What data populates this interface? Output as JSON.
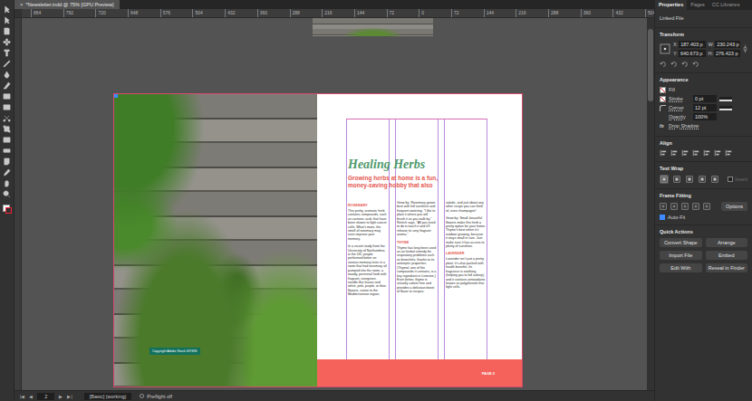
{
  "document_tab": {
    "close": "×",
    "title": "*Newsletter.indd @ 75% [GPU Preview]"
  },
  "ruler": {
    "ticks": [
      "864",
      "792",
      "720",
      "648",
      "576",
      "504",
      "432",
      "360",
      "288",
      "216",
      "144",
      "72",
      "0",
      "72",
      "144",
      "216",
      "288",
      "360",
      "432",
      "504"
    ]
  },
  "page": {
    "caption": "Copyright Adobe Stock 097496",
    "title": "Healing Herbs",
    "subtitle": "Growing herbs at home is a fun, money-saving hobby that also",
    "columns": [
      {
        "blocks": [
          {
            "kind": "heading",
            "text": "ROSEMARY"
          },
          {
            "kind": "body",
            "text": "This pretty, aromatic herb contains compounds, such as carnosic acid, that have been shown to fight cancer cells. What's more, the smell of rosemary may even improve your memory."
          },
          {
            "kind": "body",
            "text": "In a recent study from the University of Northumbria in the UK, people performed better on various memory tests in a room that had rosemary oil pumped into the room, a woody, perennial herb with fragrant, evergreen, needle-like leaves and white, pink, purple, or blue flowers, native to the Mediterranean region."
          }
        ]
      },
      {
        "blocks": [
          {
            "kind": "body",
            "text": "Grow by: Rosemary grows best with full sunshine and frequent watering. “I like to plant it where you will brush it as you walk by,” Rettich says. “All you need to do is touch it and it’ll release its very fragrant aroma.”"
          },
          {
            "kind": "heading",
            "text": "THYME"
          },
          {
            "kind": "body",
            "text": "Thyme has long been used as an herbal remedy for respiratory problems such as bronchitis, thanks to its antiseptic properties. (Thymol, one of the compounds it contains, is a key ingredient in Listerine.) Even better, thyme is virtually calorie free and provides a delicious boost of flavor to recipes."
          }
        ]
      },
      {
        "blocks": [
          {
            "kind": "body",
            "text": "salads, and just about any other recipe you can think of, even champagne!"
          },
          {
            "kind": "body",
            "text": "Grow by: Small, beautiful flowers make this herb a pretty option for your home. Thyme’s best when it’s outdoor growing, because it stays small in size. Just make sure it has access to plenty of sunshine."
          },
          {
            "kind": "heading",
            "text": "LAVENDER"
          },
          {
            "kind": "body",
            "text": "Lavender isn’t just a pretty plant; it’s also packed with health benefits. Its fragrance is soothing (helping you to fall asleep), and it contains antioxidants known as polyphenols that fight cells."
          }
        ]
      }
    ],
    "footer": "PAGE 2"
  },
  "panel": {
    "tabs": [
      {
        "label": "Properties",
        "selected": true
      },
      {
        "label": "Pages",
        "selected": false
      },
      {
        "label": "CC Libraries",
        "selected": false
      }
    ],
    "linked_file": "Linked File",
    "transform": {
      "heading": "Transform",
      "fields": [
        {
          "label": "X:",
          "value": "187.403 p"
        },
        {
          "label": "W:",
          "value": "230.243 p"
        },
        {
          "label": "Y:",
          "value": "640.673 p"
        },
        {
          "label": "H:",
          "value": "276.423 p"
        }
      ]
    },
    "appearance": {
      "heading": "Appearance",
      "fill": "Fill",
      "stroke": {
        "label": "Stroke",
        "value": "0 pt"
      },
      "corner": {
        "label": "Corner",
        "value": "12 pt"
      },
      "opacity": {
        "label": "Opacity",
        "value": "100%"
      },
      "effect": {
        "icon": "fx",
        "label": "Drop Shadow"
      }
    },
    "align": {
      "heading": "Align"
    },
    "text_wrap": {
      "heading": "Text Wrap",
      "options": [
        {
          "selected": true
        },
        {
          "selected": false
        },
        {
          "selected": false
        },
        {
          "selected": false
        },
        {
          "selected": false
        }
      ],
      "invert": {
        "label": "Invert",
        "checked": false,
        "disabled": true
      }
    },
    "frame_fitting": {
      "heading": "Frame Fitting",
      "options_button": "Options",
      "auto_fit": {
        "label": "Auto-Fit",
        "checked": true
      }
    },
    "quick_actions": {
      "heading": "Quick Actions",
      "buttons": [
        "Convert Shape",
        "Arrange",
        "Import File",
        "Embed",
        "Edit With",
        "Reveal in Finder"
      ]
    }
  },
  "status_bar": {
    "nav_prev": [
      "|◀",
      "◀"
    ],
    "page": "2",
    "nav_next": [
      "▶",
      "▶|"
    ],
    "master": "[Basic] (working)",
    "preflight": "Preflight off"
  }
}
